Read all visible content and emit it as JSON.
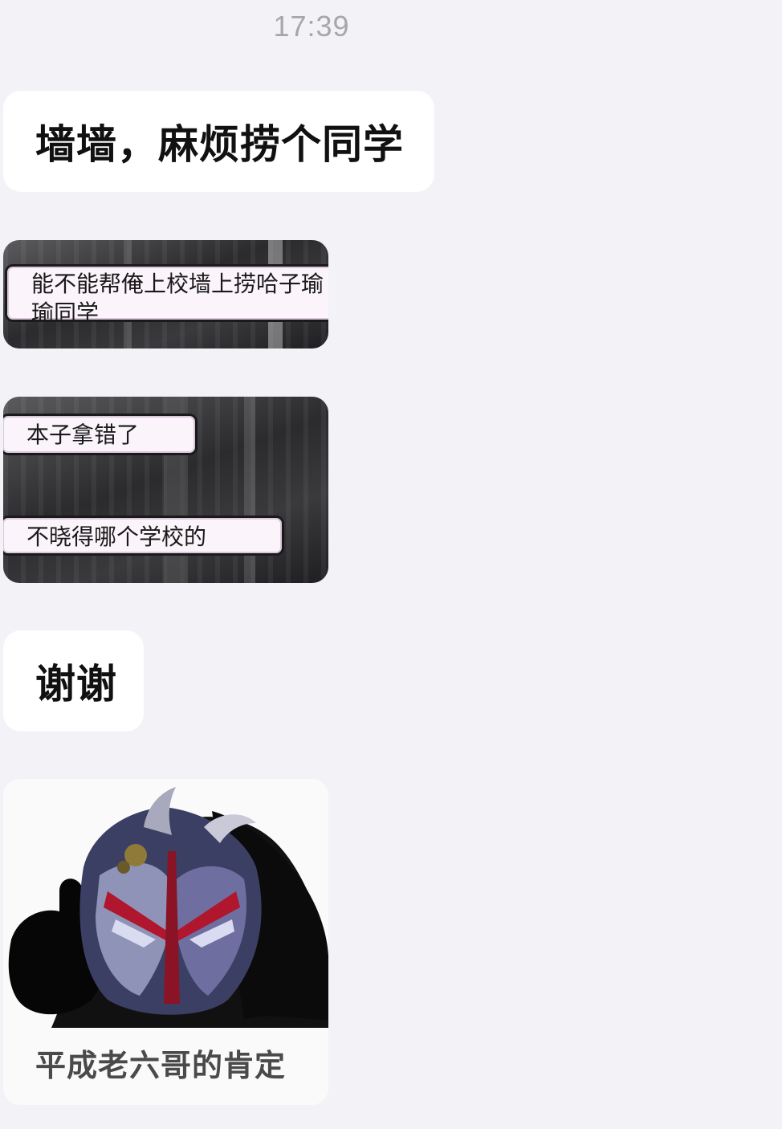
{
  "chat": {
    "timestamp": "17:39",
    "messages": [
      {
        "type": "text",
        "text": "墙墙，麻烦捞个同学"
      },
      {
        "type": "sticker",
        "captions": [
          "能不能帮俺上校墙上捞哈子瑜\n瑜同学"
        ]
      },
      {
        "type": "sticker",
        "captions": [
          "本子拿错了",
          "不晓得哪个学校的"
        ]
      },
      {
        "type": "text",
        "text": "谢谢"
      },
      {
        "type": "sticker",
        "captions": [
          "平成老六哥的肯定"
        ]
      }
    ]
  },
  "stickers": {
    "s1_line1": "能不能帮俺上校墙上捞哈子",
    "s1_line1_cut": "瑜",
    "s1_line2": "瑜同学",
    "s2_top": "本子拿错了",
    "s2_bottom": "不晓得哪个学校的",
    "s3_caption": "平成老六哥的肯定"
  },
  "icons": {
    "meme_figure": "armored-helmet-thumbs-up-image"
  }
}
